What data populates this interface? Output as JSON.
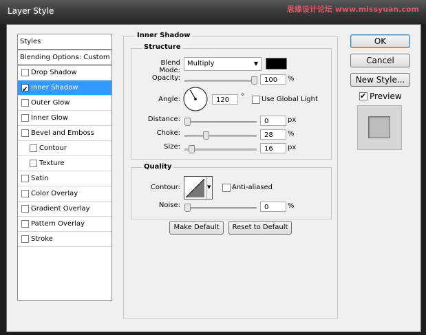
{
  "window": {
    "title": "Layer Style",
    "watermark": "思缘设计论坛 www.missyuan.com"
  },
  "style_list": {
    "styles_header": "Styles",
    "blending_header": "Blending Options: Custom",
    "items": [
      {
        "label": "Drop Shadow",
        "checked": false,
        "selected": false,
        "sub": false
      },
      {
        "label": "Inner Shadow",
        "checked": true,
        "selected": true,
        "sub": false
      },
      {
        "label": "Outer Glow",
        "checked": false,
        "selected": false,
        "sub": false
      },
      {
        "label": "Inner Glow",
        "checked": false,
        "selected": false,
        "sub": false
      },
      {
        "label": "Bevel and Emboss",
        "checked": false,
        "selected": false,
        "sub": false
      },
      {
        "label": "Contour",
        "checked": false,
        "selected": false,
        "sub": true
      },
      {
        "label": "Texture",
        "checked": false,
        "selected": false,
        "sub": true
      },
      {
        "label": "Satin",
        "checked": false,
        "selected": false,
        "sub": false
      },
      {
        "label": "Color Overlay",
        "checked": false,
        "selected": false,
        "sub": false
      },
      {
        "label": "Gradient Overlay",
        "checked": false,
        "selected": false,
        "sub": false
      },
      {
        "label": "Pattern Overlay",
        "checked": false,
        "selected": false,
        "sub": false
      },
      {
        "label": "Stroke",
        "checked": false,
        "selected": false,
        "sub": false
      }
    ]
  },
  "inner_shadow": {
    "title": "Inner Shadow",
    "structure": {
      "title": "Structure",
      "blend_mode_label": "Blend Mode:",
      "blend_mode_value": "Multiply",
      "blend_color": "#000000",
      "opacity_label": "Opacity:",
      "opacity_value": "100",
      "opacity_unit": "%",
      "opacity_fraction": 1.0,
      "angle_label": "Angle:",
      "angle_value": "120",
      "angle_unit": "°",
      "use_global_light_label": "Use Global Light",
      "use_global_light_checked": false,
      "distance_label": "Distance:",
      "distance_value": "0",
      "distance_unit": "px",
      "distance_fraction": 0.0,
      "choke_label": "Choke:",
      "choke_value": "28",
      "choke_unit": "%",
      "choke_fraction": 0.28,
      "size_label": "Size:",
      "size_value": "16",
      "size_unit": "px",
      "size_fraction": 0.065
    },
    "quality": {
      "title": "Quality",
      "contour_label": "Contour:",
      "anti_aliased_label": "Anti-aliased",
      "anti_aliased_checked": false,
      "noise_label": "Noise:",
      "noise_value": "0",
      "noise_unit": "%",
      "noise_fraction": 0.0
    },
    "make_default_label": "Make Default",
    "reset_default_label": "Reset to Default"
  },
  "buttons": {
    "ok_label": "OK",
    "cancel_label": "Cancel",
    "new_style_label": "New Style...",
    "preview_label": "Preview",
    "preview_checked": true
  }
}
